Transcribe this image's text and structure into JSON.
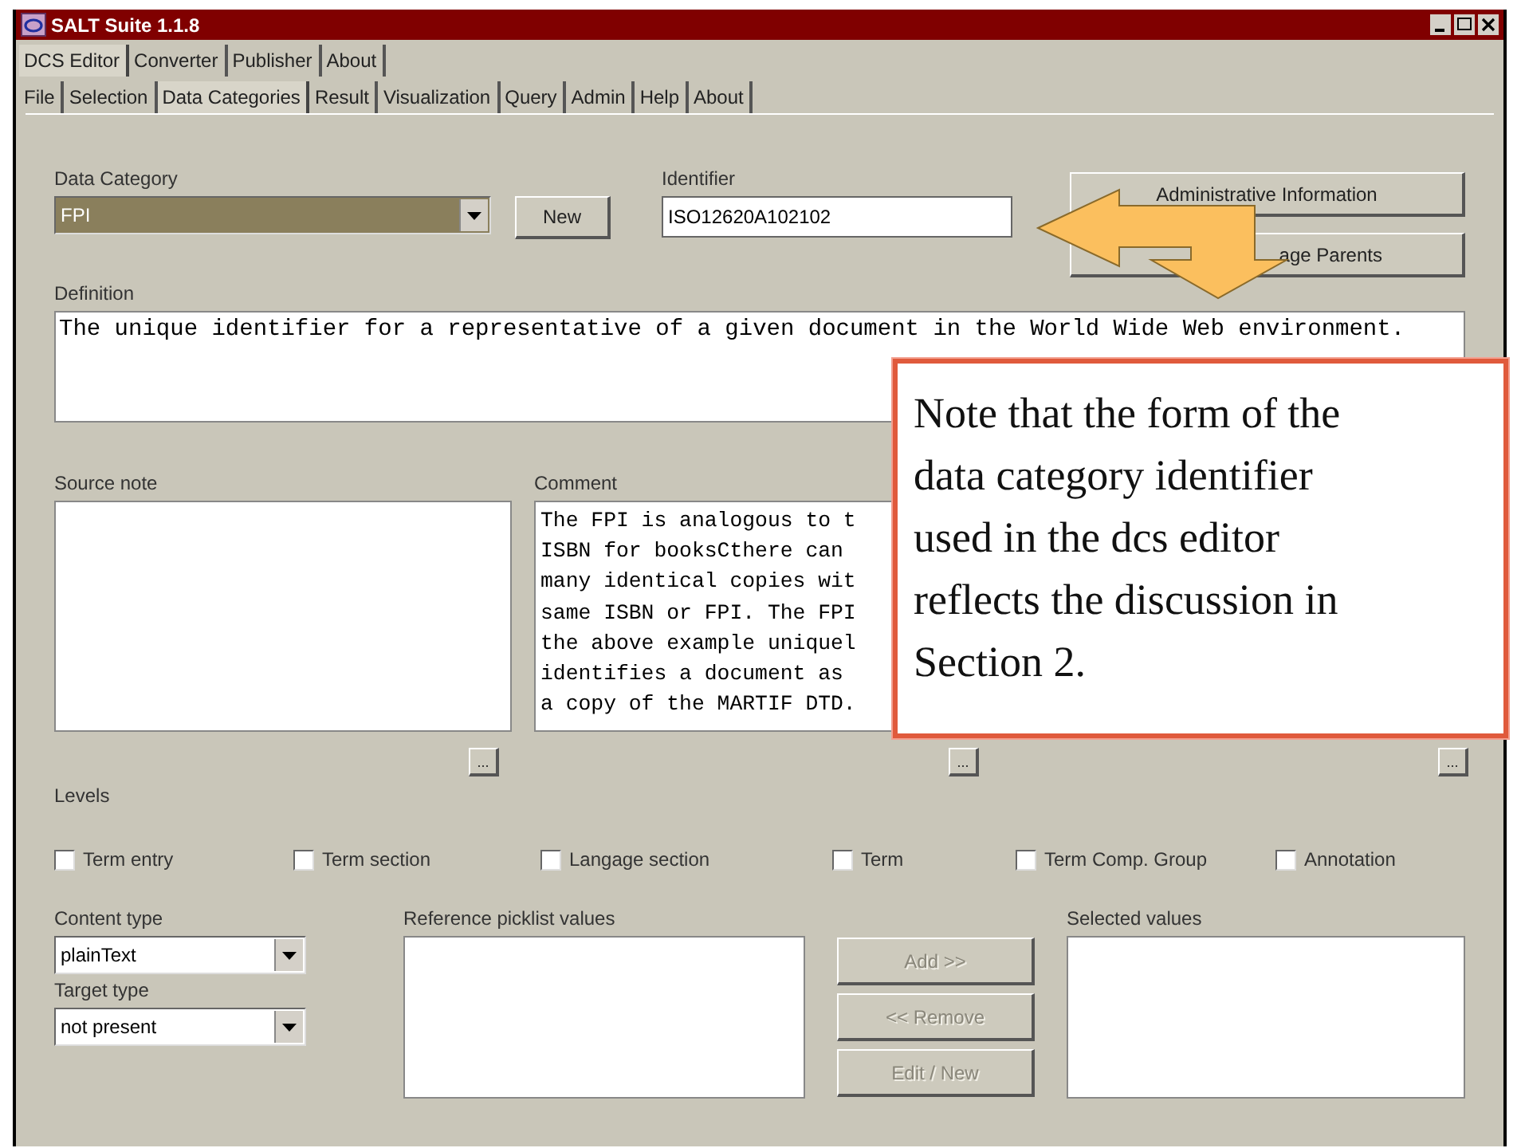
{
  "window": {
    "title": "SALT Suite 1.1.8"
  },
  "app_tabs": [
    {
      "label": "DCS Editor",
      "selected": true
    },
    {
      "label": "Converter",
      "selected": false
    },
    {
      "label": "Publisher",
      "selected": false
    },
    {
      "label": "About",
      "selected": false
    }
  ],
  "editor_tabs": [
    {
      "label": "File",
      "selected": false
    },
    {
      "label": "Selection",
      "selected": false
    },
    {
      "label": "Data Categories",
      "selected": true
    },
    {
      "label": "Result",
      "selected": false
    },
    {
      "label": "Visualization",
      "selected": false
    },
    {
      "label": "Query",
      "selected": false
    },
    {
      "label": "Admin",
      "selected": false
    },
    {
      "label": "Help",
      "selected": false
    },
    {
      "label": "About",
      "selected": false
    }
  ],
  "data_category": {
    "label": "Data Category",
    "value": "FPI"
  },
  "new_button": "New",
  "identifier": {
    "label": "Identifier",
    "value": "ISO12620A102102"
  },
  "side_buttons": [
    "Administrative Information",
    "age Parents"
  ],
  "definition": {
    "label": "Definition",
    "value": "The unique identifier for a representative of a given document in the World Wide Web environment."
  },
  "source_note": {
    "label": "Source note"
  },
  "comment": {
    "label": "Comment",
    "lines": [
      "The FPI is analogous to t",
      "ISBN for booksCthere can",
      "many identical copies wit",
      "same ISBN or FPI. The FPI",
      "the above example uniquel",
      "identifies a document as",
      "a copy of the MARTIF DTD."
    ]
  },
  "more_buttons": [
    "...",
    "...",
    "..."
  ],
  "levels": {
    "label": "Levels",
    "items": [
      {
        "label": "Term entry",
        "checked": false
      },
      {
        "label": "Term section",
        "checked": false
      },
      {
        "label": "Langage section",
        "checked": false
      },
      {
        "label": "Term",
        "checked": false
      },
      {
        "label": "Term Comp. Group",
        "checked": false
      },
      {
        "label": "Annotation",
        "checked": false
      }
    ]
  },
  "content_type": {
    "label": "Content type",
    "value": "plainText"
  },
  "target_type": {
    "label": "Target type",
    "value": "not present"
  },
  "reference_picklist": {
    "label": "Reference picklist values"
  },
  "picklist_buttons": [
    {
      "label": "Add >>",
      "disabled": true
    },
    {
      "label": "<< Remove",
      "disabled": true
    },
    {
      "label": "Edit / New",
      "disabled": true
    }
  ],
  "selected_values": {
    "label": "Selected values"
  },
  "note": "Note that the form of the data category identifier used in the dcs editor reflects the discussion in Section 2."
}
